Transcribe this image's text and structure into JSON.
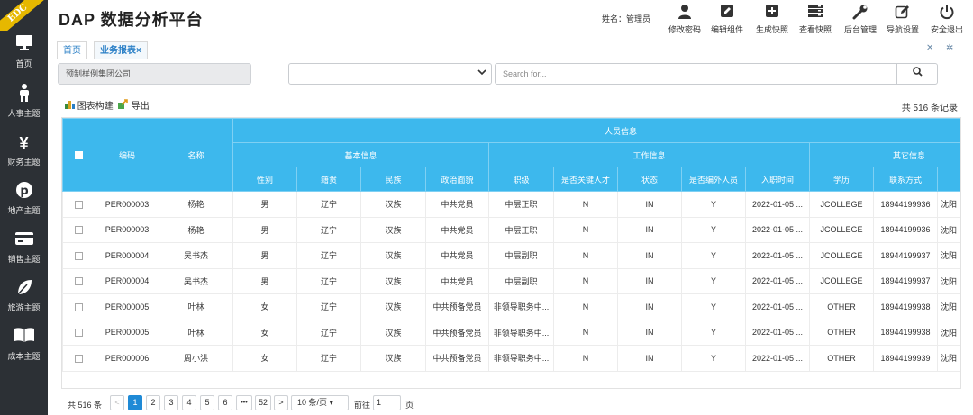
{
  "sidebar": {
    "badge": "EDC",
    "items": [
      {
        "label": "首页",
        "icon": "monitor-icon"
      },
      {
        "label": "人事主题",
        "icon": "person-icon"
      },
      {
        "label": "财务主题",
        "icon": "yen-icon"
      },
      {
        "label": "地产主题",
        "icon": "pin-icon"
      },
      {
        "label": "销售主题",
        "icon": "credit-card-icon"
      },
      {
        "label": "旅游主题",
        "icon": "leaf-icon"
      },
      {
        "label": "成本主题",
        "icon": "book-icon"
      }
    ]
  },
  "header": {
    "title": "DAP 数据分析平台",
    "user_label": "姓名：管理员",
    "tools": [
      {
        "label": "修改密码",
        "icon": "user-icon"
      },
      {
        "label": "编辑组件",
        "icon": "edit-icon"
      },
      {
        "label": "生成快照",
        "icon": "plus-box-icon"
      },
      {
        "label": "查看快照",
        "icon": "server-icon"
      },
      {
        "label": "后台管理",
        "icon": "wrench-icon"
      },
      {
        "label": "导航设置",
        "icon": "edit-square-icon"
      },
      {
        "label": "安全退出",
        "icon": "power-icon"
      }
    ]
  },
  "tabs": {
    "home": "首页",
    "report": "业务报表",
    "close": "×"
  },
  "filters": {
    "org": "预制样例集团公司",
    "select_value": "",
    "search_placeholder": "Search for..."
  },
  "actions": {
    "chart_build": "图表构建",
    "export": "导出"
  },
  "record_count": "共 516 条记录",
  "table": {
    "group_top": "人员信息",
    "groups": [
      "基本信息",
      "工作信息",
      "其它信息"
    ],
    "headers": [
      "编码",
      "名称",
      "性别",
      "籍贯",
      "民族",
      "政治面貌",
      "职级",
      "是否关键人才",
      "状态",
      "是否编外人员",
      "入职时间",
      "学历",
      "联系方式",
      "现"
    ],
    "rows": [
      [
        "PER000003",
        "杨艳",
        "男",
        "辽宁",
        "汉族",
        "中共党员",
        "中层正职",
        "N",
        "IN",
        "Y",
        "2022-01-05 ...",
        "JCOLLEGE",
        "18944199936",
        "沈阳"
      ],
      [
        "PER000003",
        "杨艳",
        "男",
        "辽宁",
        "汉族",
        "中共党员",
        "中层正职",
        "N",
        "IN",
        "Y",
        "2022-01-05 ...",
        "JCOLLEGE",
        "18944199936",
        "沈阳"
      ],
      [
        "PER000004",
        "吴书杰",
        "男",
        "辽宁",
        "汉族",
        "中共党员",
        "中层副职",
        "N",
        "IN",
        "Y",
        "2022-01-05 ...",
        "JCOLLEGE",
        "18944199937",
        "沈阳"
      ],
      [
        "PER000004",
        "吴书杰",
        "男",
        "辽宁",
        "汉族",
        "中共党员",
        "中层副职",
        "N",
        "IN",
        "Y",
        "2022-01-05 ...",
        "JCOLLEGE",
        "18944199937",
        "沈阳"
      ],
      [
        "PER000005",
        "叶林",
        "女",
        "辽宁",
        "汉族",
        "中共预备党员",
        "非领导职务中...",
        "N",
        "IN",
        "Y",
        "2022-01-05 ...",
        "OTHER",
        "18944199938",
        "沈阳"
      ],
      [
        "PER000005",
        "叶林",
        "女",
        "辽宁",
        "汉族",
        "中共预备党员",
        "非领导职务中...",
        "N",
        "IN",
        "Y",
        "2022-01-05 ...",
        "OTHER",
        "18944199938",
        "沈阳"
      ],
      [
        "PER000006",
        "周小洪",
        "女",
        "辽宁",
        "汉族",
        "中共预备党员",
        "非领导职务中...",
        "N",
        "IN",
        "Y",
        "2022-01-05 ...",
        "OTHER",
        "18944199939",
        "沈阳"
      ]
    ]
  },
  "pager": {
    "total": "共 516 条",
    "prev": "<",
    "pages": [
      "1",
      "2",
      "3",
      "4",
      "5",
      "6",
      "•••",
      "52"
    ],
    "next": ">",
    "page_size": "10 条/页",
    "goto_label": "前往",
    "goto_value": "1",
    "goto_unit": "页"
  }
}
